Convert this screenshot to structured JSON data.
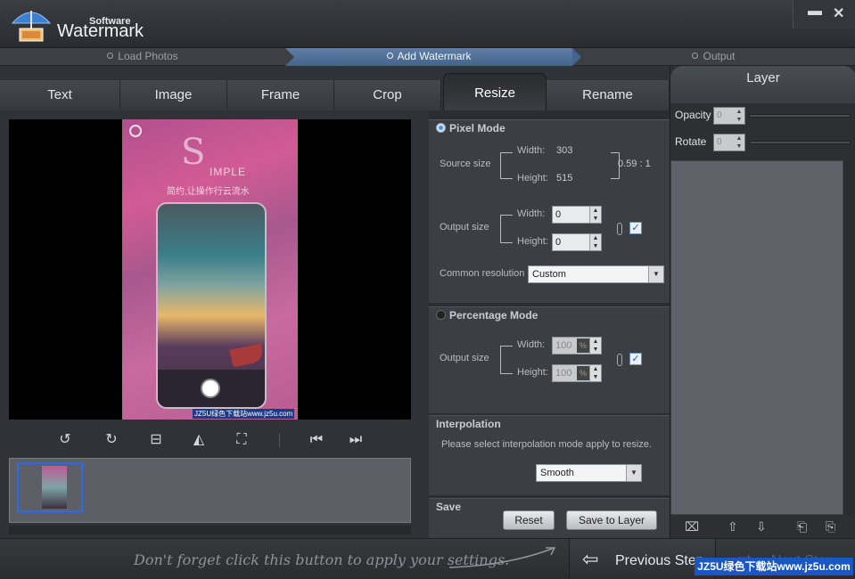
{
  "app": {
    "title_small": "Software",
    "title_big": "Watermark"
  },
  "window": {
    "minimize_glyph": "▬",
    "close_glyph": "✕"
  },
  "steps": [
    {
      "label": "Load Photos",
      "active": false
    },
    {
      "label": "Add Watermark",
      "active": true
    },
    {
      "label": "Output",
      "active": false
    }
  ],
  "tabs": [
    {
      "label": "Text"
    },
    {
      "label": "Image"
    },
    {
      "label": "Frame"
    },
    {
      "label": "Crop"
    },
    {
      "label": "Resize",
      "active": true
    },
    {
      "label": "Rename"
    }
  ],
  "preview": {
    "photo_title": "S",
    "photo_title_rest": "IMPLE",
    "photo_tagline": "简约,让操作行云流水",
    "watermark_text": "JZ5U绿色下载站www.jz5u.com"
  },
  "resize": {
    "pixel_mode": {
      "label": "Pixel Mode",
      "selected": true,
      "source_size_label": "Source size",
      "width_label": "Width:",
      "width_value": "303",
      "height_label": "Height:",
      "height_value": "515",
      "ratio": "0.59 : 1",
      "output_size_label": "Output size",
      "out_width": "0",
      "out_height": "0",
      "keep_ratio": true,
      "common_resolution_label": "Common resolution",
      "common_resolution_value": "Custom"
    },
    "percentage_mode": {
      "label": "Percentage Mode",
      "selected": false,
      "output_size_label": "Output size",
      "width_label": "Width:",
      "width_value": "100",
      "height_label": "Height:",
      "height_value": "100",
      "percent_symbol": "%",
      "keep_ratio": true
    },
    "interpolation": {
      "label": "Interpolation",
      "description": "Please select interpolation mode apply to resize.",
      "value": "Smooth"
    },
    "save": {
      "label": "Save",
      "reset_label": "Reset",
      "save_to_layer_label": "Save to Layer"
    }
  },
  "layer_panel": {
    "title": "Layer",
    "opacity_label": "Opacity",
    "opacity_value": "0",
    "rotate_label": "Rotate",
    "rotate_value": "0"
  },
  "bottom": {
    "hint": "Don't forget click this button to apply your settings.",
    "previous_label": "Previous Step",
    "next_label": "Next Step"
  },
  "site_badge": "JZ5U绿色下载站www.jz5u.com",
  "colors": {
    "accent": "#4f72a0",
    "checkbox": "#1e5fb8"
  }
}
